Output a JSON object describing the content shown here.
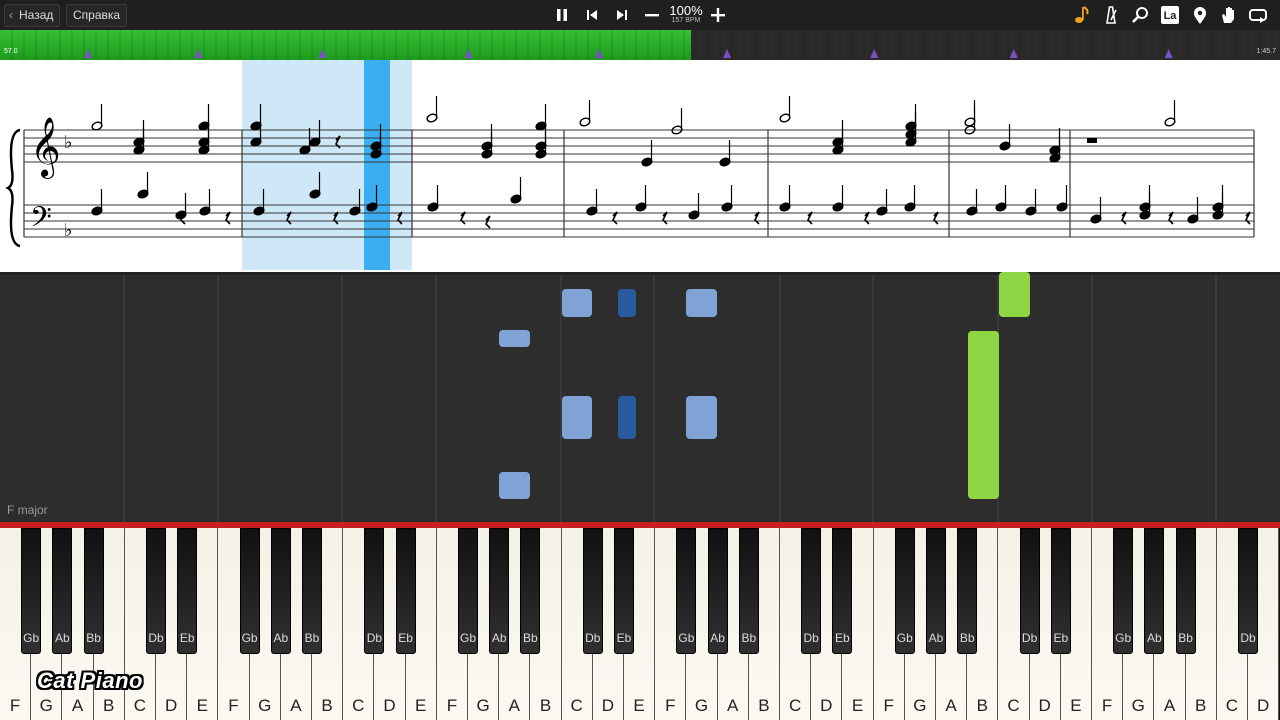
{
  "toolbar": {
    "back_label": "Назад",
    "help_label": "Справка",
    "tempo_percent": "100%",
    "tempo_bpm": "157 BPM",
    "icons": [
      "pause-icon",
      "previous-icon",
      "next-icon",
      "minus-icon",
      "plus-icon",
      "note-icon",
      "metronome-icon",
      "magnifier-icon",
      "la-icon",
      "marker-icon",
      "hand-icon",
      "loop-icon"
    ],
    "la_label": "La"
  },
  "progress": {
    "start_time": "57.0",
    "end_time": "1:45.7",
    "played_fraction": 0.54,
    "marker_positions_fraction": [
      0.069,
      0.155,
      0.252,
      0.366,
      0.468,
      0.568,
      0.683,
      0.792,
      0.913
    ],
    "colors": {
      "played": "#2aa82a",
      "marker": "#7a4fc8"
    }
  },
  "roll": {
    "key_signature": "F major",
    "colors": {
      "left_hand": "#7fa3d4",
      "left_hand_active": "#2a5aa0",
      "right_hand": "#8fd645"
    }
  },
  "keyboard": {
    "white_keys": [
      "F",
      "G",
      "A",
      "B",
      "C",
      "D",
      "E",
      "F",
      "G",
      "A",
      "B",
      "C",
      "D",
      "E",
      "F",
      "G",
      "A",
      "B",
      "C",
      "D",
      "E",
      "F",
      "G",
      "A",
      "B",
      "C",
      "D",
      "E",
      "F",
      "G",
      "A",
      "B",
      "C",
      "D",
      "E",
      "F",
      "G",
      "A",
      "B",
      "C",
      "D"
    ],
    "black_keys": [
      "Gb",
      "Ab",
      "Bb",
      "Db",
      "Eb",
      "Gb",
      "Ab",
      "Bb",
      "Db",
      "Eb",
      "Gb",
      "Ab",
      "Bb",
      "Db",
      "Eb",
      "Gb",
      "Ab",
      "Bb",
      "Db",
      "Eb",
      "Gb",
      "Ab",
      "Bb",
      "Db",
      "Eb",
      "Gb",
      "Ab",
      "Bb",
      "Db"
    ]
  },
  "watermark": "Cat Piano"
}
